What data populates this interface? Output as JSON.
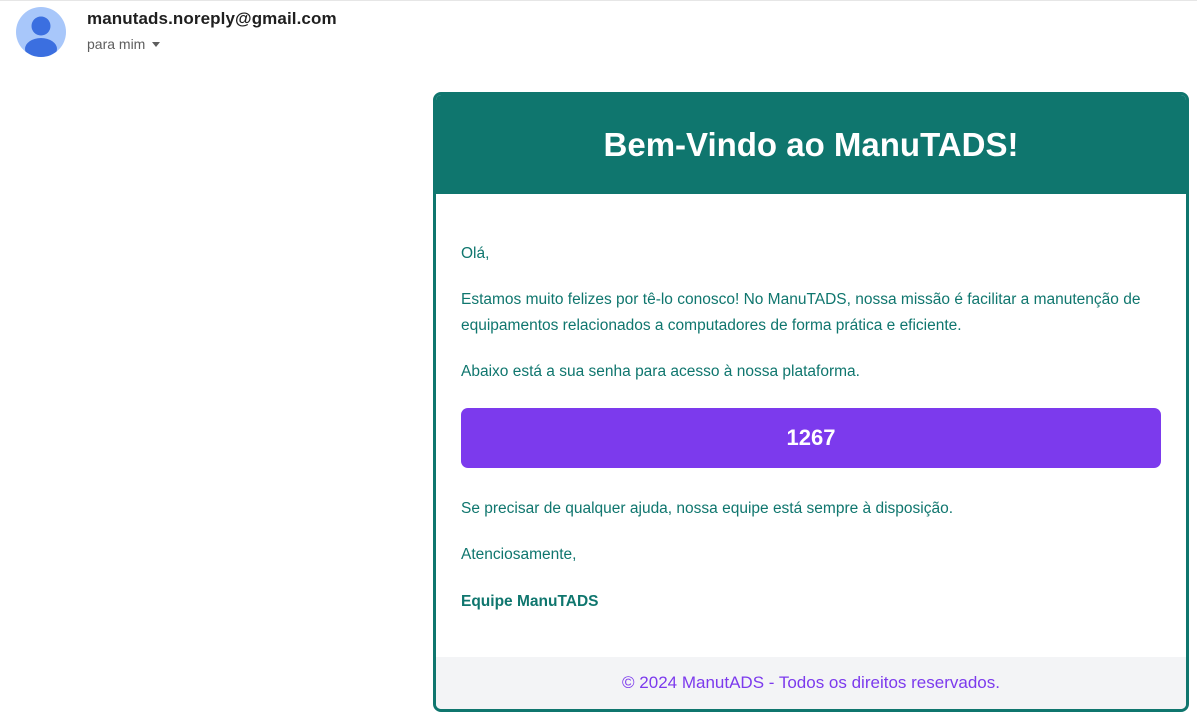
{
  "header": {
    "sender": "manutads.noreply@gmail.com",
    "recipient": "para mim"
  },
  "email": {
    "title": "Bem-Vindo ao ManuTADS!",
    "greeting": "Olá,",
    "paragraph1": "Estamos muito felizes por tê-lo conosco! No ManuTADS, nossa missão é facilitar a manutenção de equipamentos relacionados a computadores de forma prática e eficiente.",
    "paragraph2": "Abaixo está a sua senha para acesso à nossa plataforma.",
    "password": "1267",
    "paragraph3": "Se precisar de qualquer ajuda, nossa equipe está sempre à disposição.",
    "closing": "Atenciosamente,",
    "signature": "Equipe ManuTADS",
    "footer": "© 2024 ManutADS - Todos os direitos reservados."
  },
  "colors": {
    "primary": "#0f766e",
    "accent": "#7c3aed",
    "footer_bg": "#f3f4f6",
    "avatar_bg": "#a8c7fa",
    "avatar_fg": "#3b6fe0"
  },
  "icons": {
    "avatar": "person-avatar-icon",
    "dropdown": "caret-down-icon"
  }
}
